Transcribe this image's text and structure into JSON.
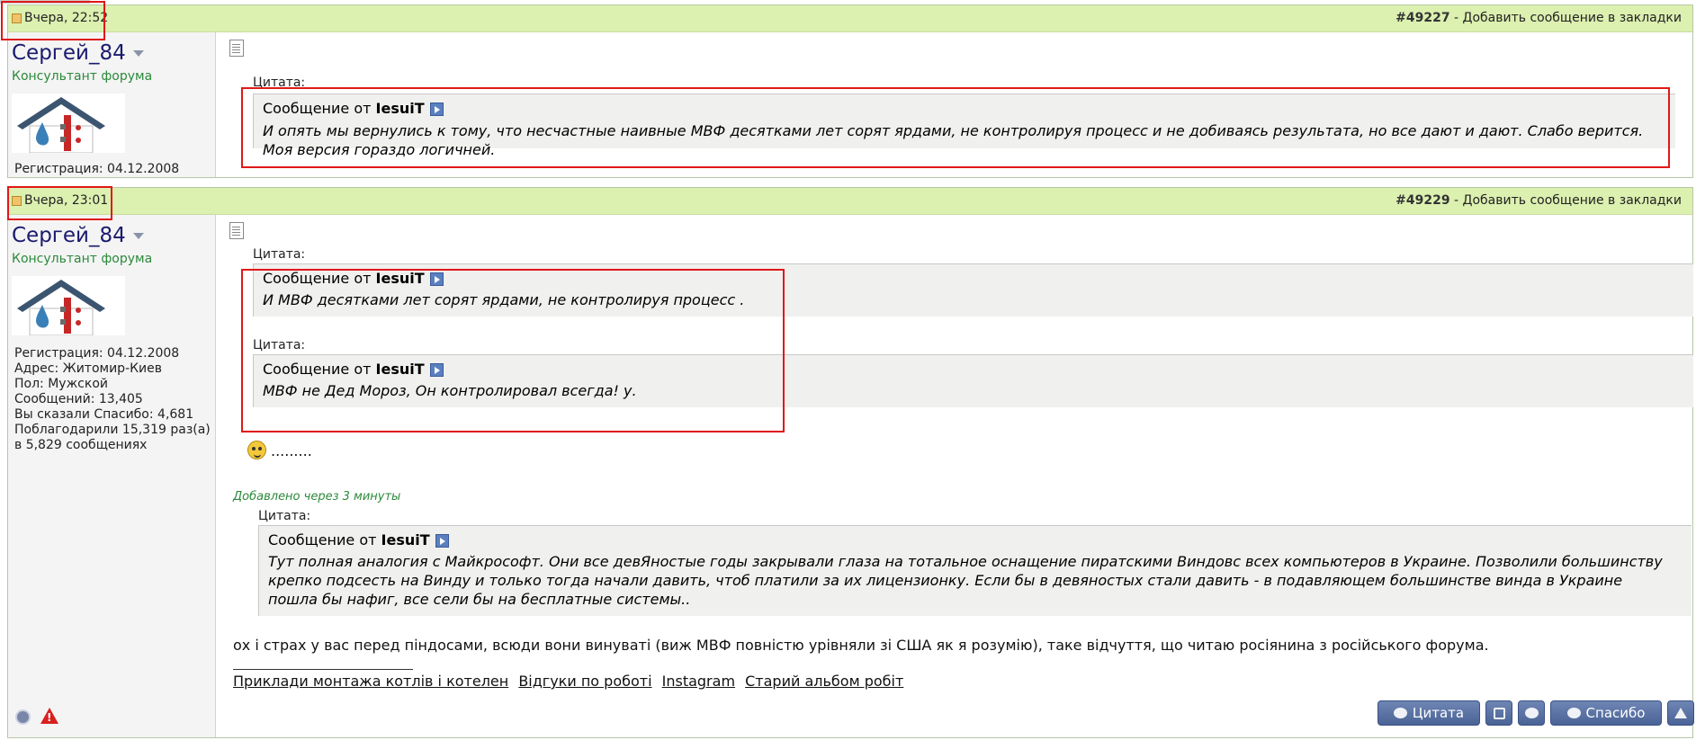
{
  "posts": [
    {
      "date": "Вчера, 22:52",
      "post_number": "#49227",
      "bookmark_label": "Добавить сообщение в закладки",
      "separator": " - ",
      "user": {
        "name": "Сергей_84",
        "title": "Консультант форума",
        "info": [
          "Регистрация: 04.12.2008"
        ]
      },
      "quotes": [
        {
          "label": "Цитата:",
          "author_prefix": "Сообщение от",
          "author": "IesuiT",
          "text": "И опять мы вернулись к тому, что несчастные наивные МВФ десятками лет сорят ярдами, не контролируя процесс и не добиваясь результата, но все дают и дают. Слабо верится. Моя версия гораздо логичней."
        }
      ]
    },
    {
      "date": "Вчера, 23:01",
      "post_number": "#49229",
      "bookmark_label": "Добавить сообщение в закладки",
      "separator": " - ",
      "user": {
        "name": "Сергей_84",
        "title": "Консультант форума",
        "info": [
          "Регистрация: 04.12.2008",
          "Адрес: Житомир-Киев",
          "Пол: Мужской",
          "Сообщений: 13,405",
          "Вы сказали Спасибо: 4,681",
          "Поблагодарили 15,319 раз(а)",
          "в 5,829 сообщениях"
        ]
      },
      "quotes": [
        {
          "label": "Цитата:",
          "author_prefix": "Сообщение от",
          "author": "IesuiT",
          "text": "И МВФ десятками лет сорят ярдами, не контролируя процесс ."
        },
        {
          "label": "Цитата:",
          "author_prefix": "Сообщение от",
          "author": "IesuiT",
          "text": "МВФ не Дед Мороз, Он контролировал всегда! у."
        },
        {
          "label": "Цитата:",
          "author_prefix": "Сообщение от",
          "author": "IesuiT",
          "text": "Тут полная аналогия с Майкрософт. Они все девЯностые годы закрывали глаза на тотальное оснащение пиратскими Виндовс всех компьютеров в Украине. Позволили большинству крепко подсесть на Винду и только тогда начали давить, чтоб платили за их лицензионку. Если бы в девяностых стали давить - в подавляющем большинстве винда в Украине пошла бы нафиг, все сели бы на бесплатные системы.."
        }
      ],
      "smile_text": ".........",
      "added_note": "Добавлено через 3 минуты",
      "body": "ох і страх у вас перед піндосами, всюди вони винуваті (виж МВФ повністю урівняли зі США як я розумію), таке відчуття, що читаю росіянина з російського форума.",
      "signature_links": [
        "Приклади монтажа котлів і котелен",
        "Відгуки по роботі",
        "Instagram",
        "Старий альбом робіт"
      ],
      "buttons": {
        "quote": "Цитата",
        "thanks": "Спасибо"
      }
    }
  ],
  "colors": {
    "header_bg": "#dcf0b0",
    "highlight_red": "#e01818",
    "user_title": "#2b8a3a",
    "button_blue": "#4a6396"
  }
}
